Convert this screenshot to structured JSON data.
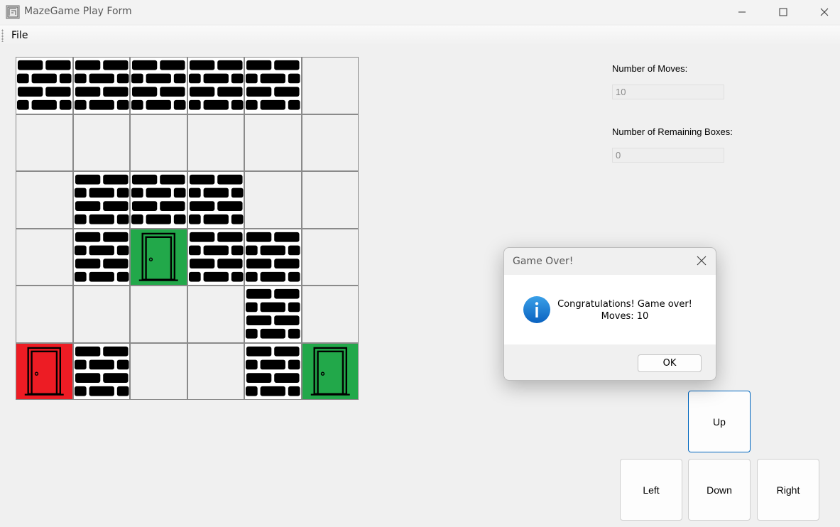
{
  "window": {
    "title": "MazeGame Play Form"
  },
  "menu": {
    "file": "File"
  },
  "maze": {
    "rows": 6,
    "cols": 6,
    "cells": [
      [
        "wall",
        "wall",
        "wall",
        "wall",
        "wall",
        "empty"
      ],
      [
        "empty",
        "empty",
        "empty",
        "empty",
        "empty",
        "empty"
      ],
      [
        "empty",
        "wall",
        "wall",
        "wall",
        "empty",
        "empty"
      ],
      [
        "empty",
        "wall",
        "green-door",
        "wall",
        "wall",
        "empty"
      ],
      [
        "empty",
        "empty",
        "empty",
        "empty",
        "wall",
        "empty"
      ],
      [
        "red-door",
        "wall",
        "empty",
        "empty",
        "wall",
        "green-door"
      ]
    ],
    "colors": {
      "green_door": "#22a84a",
      "red_door": "#ed1c24",
      "brick": "#000000"
    }
  },
  "stats": {
    "moves_label": "Number of Moves:",
    "moves_value": "10",
    "boxes_label": "Number of Remaining Boxes:",
    "boxes_value": "0"
  },
  "controls": {
    "up": "Up",
    "left": "Left",
    "down": "Down",
    "right": "Right"
  },
  "dialog": {
    "title": "Game Over!",
    "line1": "Congratulations! Game over!",
    "line2": "Moves: 10",
    "ok": "OK",
    "icon": "info-icon"
  }
}
